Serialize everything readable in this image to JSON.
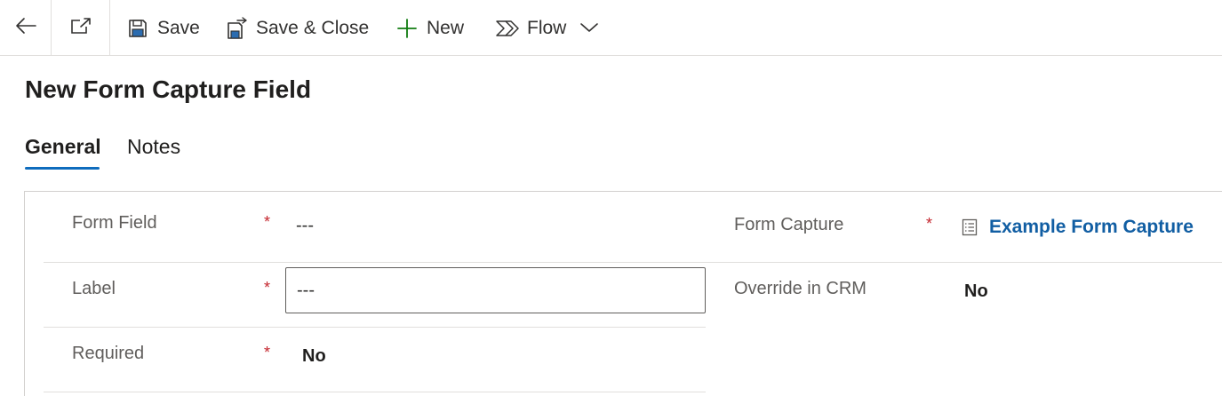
{
  "toolbar": {
    "back_icon": "arrow-left-icon",
    "popout_icon": "open-in-new-window-icon",
    "save_label": "Save",
    "save_close_label": "Save & Close",
    "new_label": "New",
    "flow_label": "Flow",
    "accent_new": "#107c10"
  },
  "page": {
    "title": "New Form Capture Field"
  },
  "tabs": [
    {
      "label": "General",
      "selected": true
    },
    {
      "label": "Notes",
      "selected": false
    }
  ],
  "form": {
    "form_field": {
      "label": "Form Field",
      "required_marker": "*",
      "value": "---"
    },
    "label": {
      "label": "Label",
      "required_marker": "*",
      "value": "---"
    },
    "required": {
      "label": "Required",
      "required_marker": "*",
      "value": "No"
    },
    "form_capture": {
      "label": "Form Capture",
      "required_marker": "*",
      "value": "Example Form Capture"
    },
    "override_in_crm": {
      "label": "Override in CRM",
      "value": "No"
    }
  },
  "colors": {
    "link": "#115ea3",
    "tab_underline": "#0f6cbd",
    "required": "#c4262e"
  }
}
